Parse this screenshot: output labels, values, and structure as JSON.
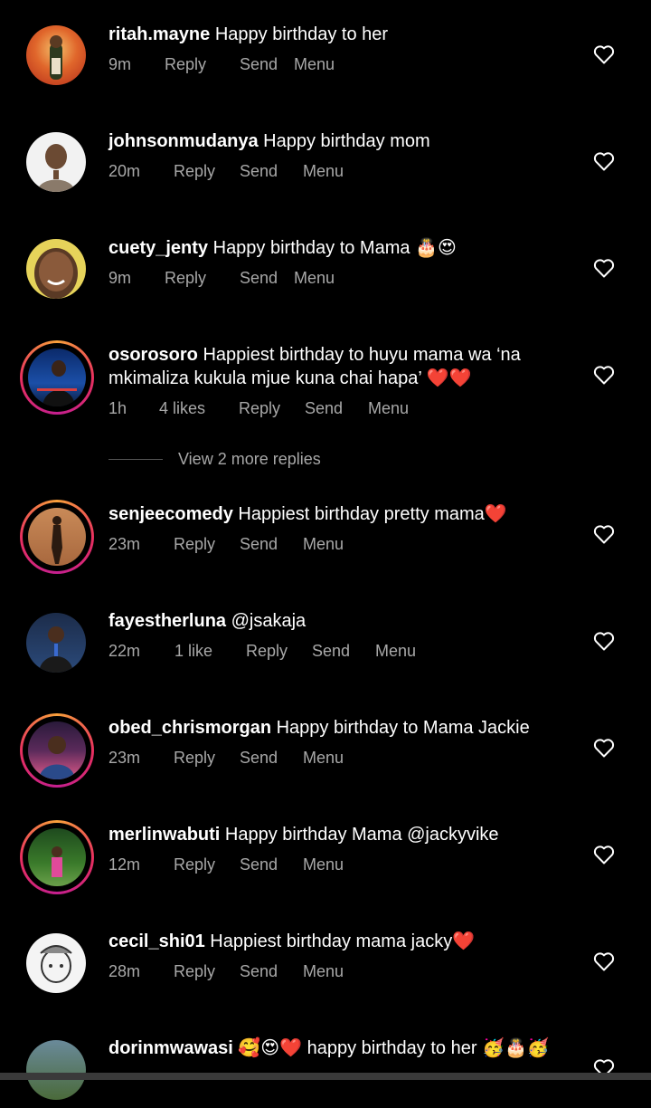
{
  "comments": [
    {
      "user": "ritah.mayne",
      "text": " Happy birthday to her",
      "time": "9m",
      "likes": "",
      "reply": "Reply",
      "send": "Send",
      "menu": "Menu"
    },
    {
      "user": "johnsonmudanya",
      "text": " Happy birthday mom",
      "time": "20m",
      "likes": "",
      "reply": "Reply",
      "send": "Send",
      "menu": "Menu"
    },
    {
      "user": "cuety_jenty",
      "text": " Happy birthday to Mama 🎂😍",
      "time": "9m",
      "likes": "",
      "reply": "Reply",
      "send": "Send",
      "menu": "Menu"
    },
    {
      "user": "osorosoro",
      "text": " Happiest birthday to huyu mama wa ‘na mkimaliza kukula mjue kuna chai hapa’ ❤️❤️",
      "time": "1h",
      "likes": "4 likes",
      "reply": "Reply",
      "send": "Send",
      "menu": "Menu"
    },
    {
      "user": "senjeecomedy",
      "text": " Happiest birthday pretty mama❤️",
      "time": "23m",
      "likes": "",
      "reply": "Reply",
      "send": "Send",
      "menu": "Menu"
    },
    {
      "user": "fayestherluna",
      "text": " @jsakaja",
      "time": "22m",
      "likes": "1 like",
      "reply": "Reply",
      "send": "Send",
      "menu": "Menu"
    },
    {
      "user": "obed_chrismorgan",
      "text": " Happy birthday to Mama Jackie",
      "time": "23m",
      "likes": "",
      "reply": "Reply",
      "send": "Send",
      "menu": "Menu"
    },
    {
      "user": "merlinwabuti",
      "text": " Happy birthday Mama @jackyvike",
      "time": "12m",
      "likes": "",
      "reply": "Reply",
      "send": "Send",
      "menu": "Menu"
    },
    {
      "user": "cecil_shi01",
      "text": " Happiest birthday mama jacky❤️",
      "time": "28m",
      "likes": "",
      "reply": "Reply",
      "send": "Send",
      "menu": "Menu"
    },
    {
      "user": "dorinmwawasi",
      "text": " 🥰😍❤️ happy birthday to her 🥳🎂🥳",
      "time": "",
      "likes": "",
      "reply": "",
      "send": "",
      "menu": ""
    }
  ],
  "view_more": "View 2 more replies",
  "icons": {
    "like": "heart-outline-icon"
  },
  "colors": {
    "background": "#000000",
    "text": "#ffffff",
    "meta": "#a8a8a8",
    "story_ring": "#e8305e"
  }
}
